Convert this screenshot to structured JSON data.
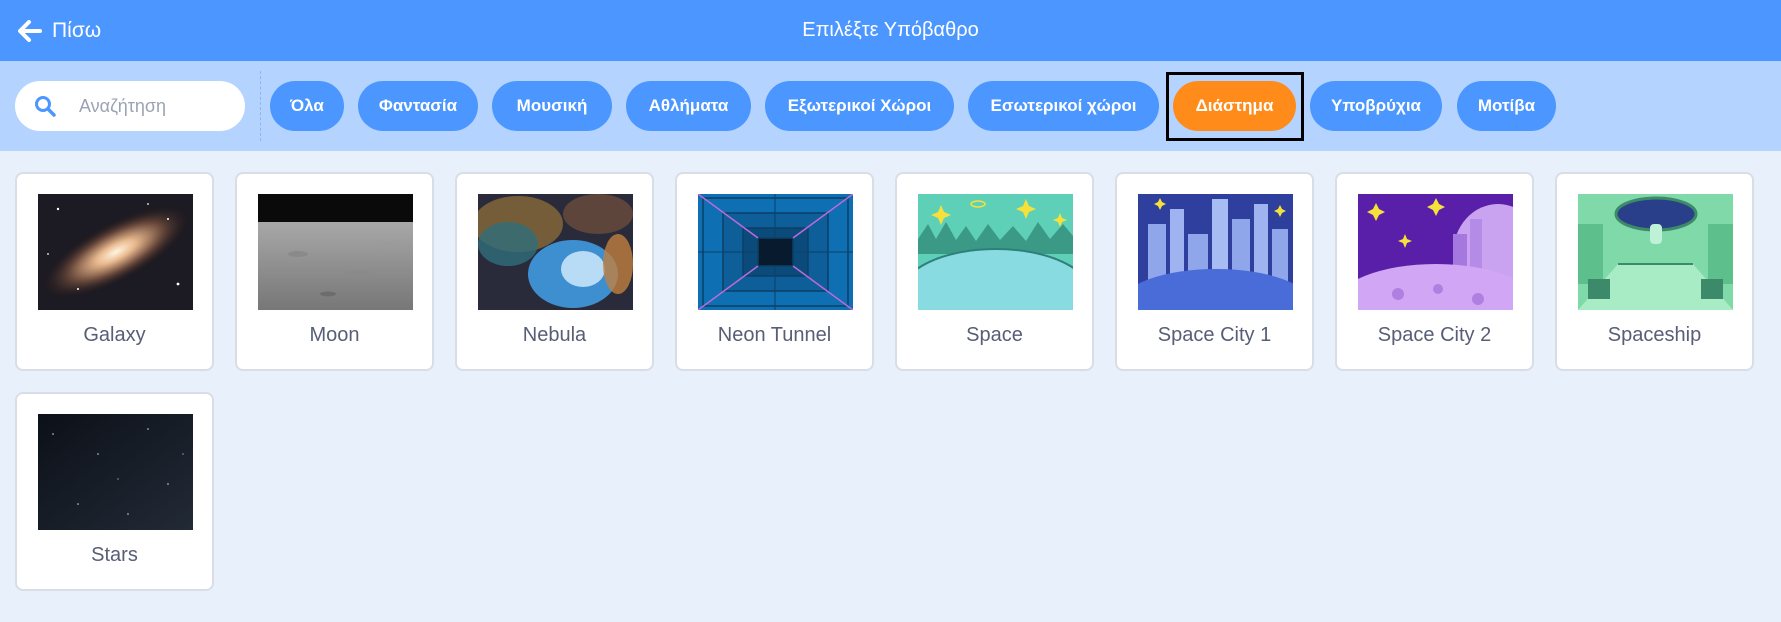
{
  "header": {
    "back_label": "Πίσω",
    "title": "Επιλέξτε Υπόβαθρο"
  },
  "search": {
    "placeholder": "Αναζήτηση",
    "value": ""
  },
  "tags": [
    {
      "label": "Όλα",
      "active": false
    },
    {
      "label": "Φαντασία",
      "active": false
    },
    {
      "label": "Μουσική",
      "active": false
    },
    {
      "label": "Αθλήματα",
      "active": false
    },
    {
      "label": "Εξωτερικοί Χώροι",
      "active": false
    },
    {
      "label": "Εσωτερικοί χώροι",
      "active": false
    },
    {
      "label": "Διάστημα",
      "active": true
    },
    {
      "label": "Υποβρύχια",
      "active": false
    },
    {
      "label": "Μοτίβα",
      "active": false
    }
  ],
  "backdrops": [
    {
      "name": "Galaxy"
    },
    {
      "name": "Moon"
    },
    {
      "name": "Nebula"
    },
    {
      "name": "Neon Tunnel"
    },
    {
      "name": "Space"
    },
    {
      "name": "Space City 1"
    },
    {
      "name": "Space City 2"
    },
    {
      "name": "Spaceship"
    },
    {
      "name": "Stars"
    }
  ],
  "colors": {
    "header": "#4c97ff",
    "filter_bar": "#b5d3ff",
    "tag": "#4c97ff",
    "tag_active": "#ff8c1a",
    "background": "#e8f0fb"
  }
}
